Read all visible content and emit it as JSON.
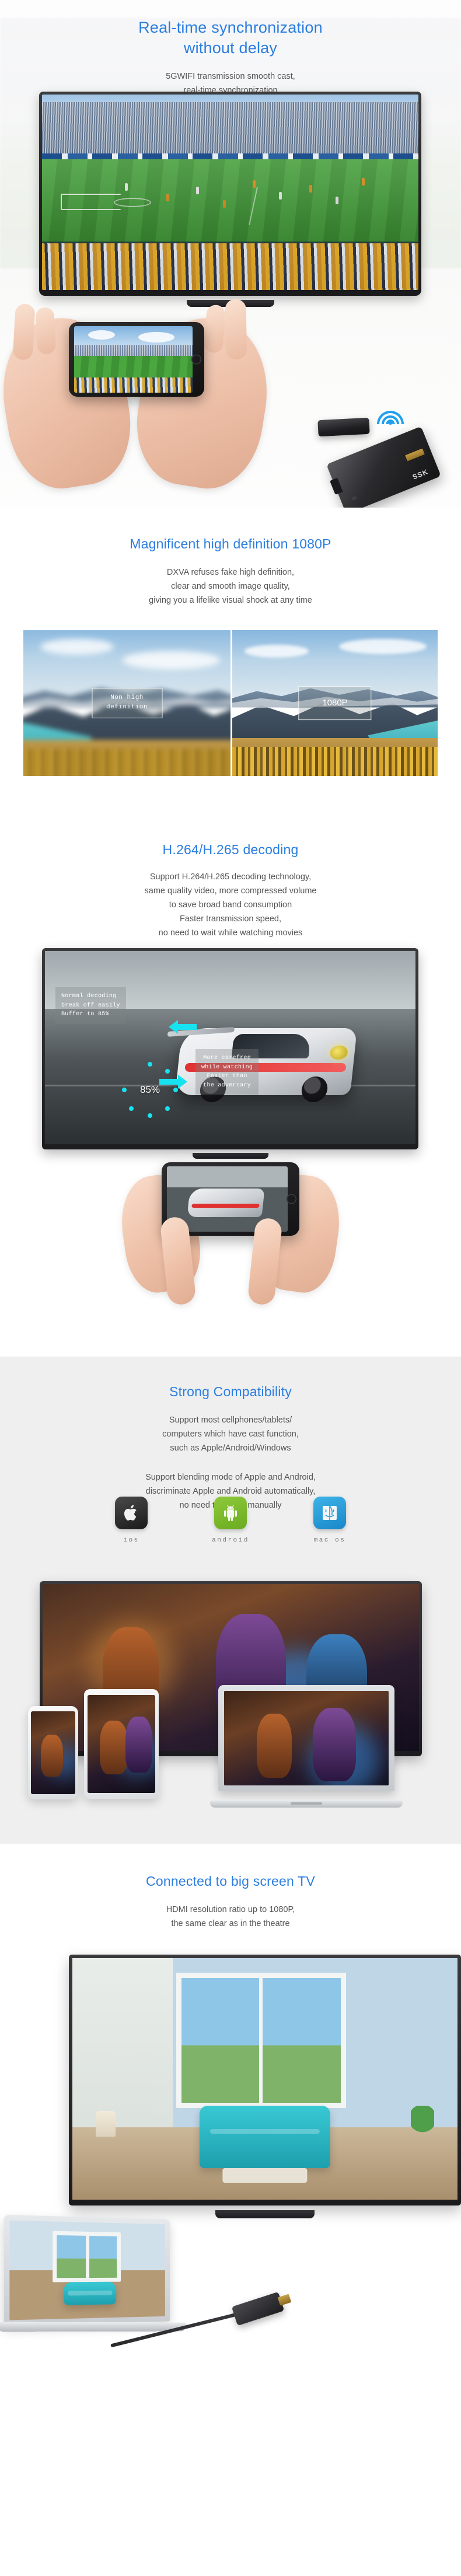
{
  "sections": [
    {
      "id": "realtime-sync",
      "headline_line1": "Real-time synchronization",
      "headline_line2": "without delay",
      "body_line1": "5GWIFI transmission smooth cast,",
      "body_line2": "real-time synchronization",
      "dongle_brand": "SSK",
      "icons": [
        "wifi-icon",
        "hdmi-dongle",
        "smartphone",
        "television"
      ]
    },
    {
      "id": "high-definition-1080p",
      "headline": "Magnificent high definition 1080P",
      "body_line1": "DXVA refuses fake high definition,",
      "body_line2": "clear and smooth image quality,",
      "body_line3": "giving you a lifelike visual shock at any time",
      "compare_left_label": "Non high\ndefinition",
      "compare_right_label": "1080P"
    },
    {
      "id": "h264-h265-decoding",
      "headline": "H.264/H.265 decoding",
      "body_line1": "Support H.264/H.265 decoding technology,",
      "body_line2": "same quality video, more compressed volume",
      "body_line3": "to save broad band consumption",
      "body_line4": "Faster transmission speed,",
      "body_line5": "no need to wait while watching movies",
      "overlay_left": "Normal decoding\nbreak off easily\n Buffer to 85%",
      "overlay_right": "More carefree\nwhile watching\nFaster than\nthe adversary",
      "buffer_percent": "85%"
    },
    {
      "id": "strong-compatibility",
      "headline": "Strong Compatibility",
      "body_line1": "Support most cellphones/tablets/",
      "body_line2": "computers which have cast function,",
      "body_line3": "such as Apple/Android/Windows",
      "body2_line1": "Support blending mode of Apple and Android,",
      "body2_line2": "discriminate Apple and Android automatically,",
      "body2_line3": "no need to switch manually",
      "os_items": [
        {
          "label": "ios",
          "icon": "apple-logo-icon",
          "color": "#262626"
        },
        {
          "label": "android",
          "icon": "android-robot-icon",
          "color": "#7cbb2c"
        },
        {
          "label": "mac os",
          "icon": "finder-face-icon",
          "color": "#2ba0db"
        }
      ]
    },
    {
      "id": "connected-big-screen",
      "headline": "Connected to big screen TV",
      "body_line1": "HDMI resolution ratio up to 1080P,",
      "body_line2": "the same clear as in the theatre"
    }
  ],
  "colors": {
    "accent_blue": "#2b7de0",
    "body_text": "#555555",
    "section_gray": "#efefef",
    "cyan_arrow": "#17e3f0",
    "wifi_blue": "#1e9ff0"
  }
}
